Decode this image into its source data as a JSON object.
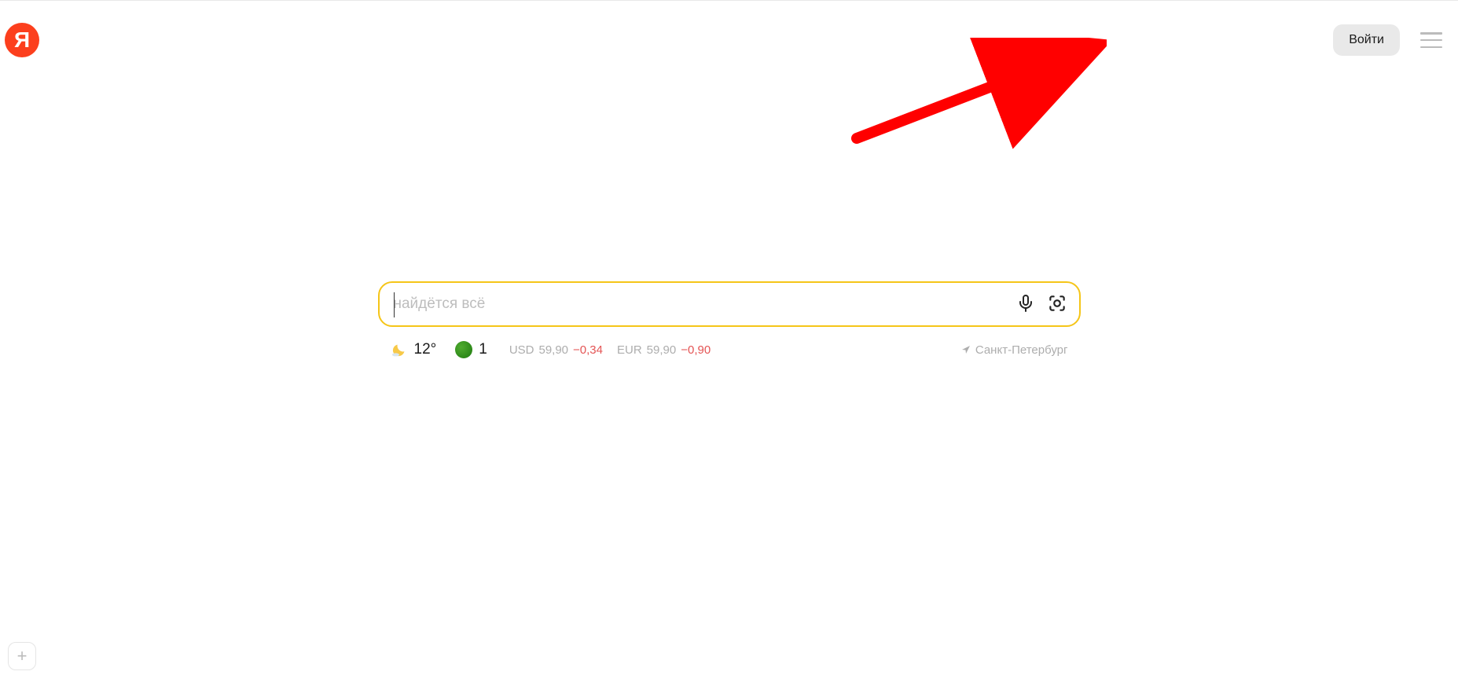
{
  "logo": {
    "letter": "Я"
  },
  "header": {
    "login_label": "Войти"
  },
  "search": {
    "placeholder": "найдётся всё"
  },
  "info": {
    "weather": {
      "temperature": "12°"
    },
    "traffic": {
      "level": "1"
    },
    "rates": [
      {
        "currency": "USD",
        "value": "59,90",
        "delta": "−0,34"
      },
      {
        "currency": "EUR",
        "value": "59,90",
        "delta": "−0,90"
      }
    ],
    "location": "Санкт-Петербург"
  },
  "plus_label": "+"
}
